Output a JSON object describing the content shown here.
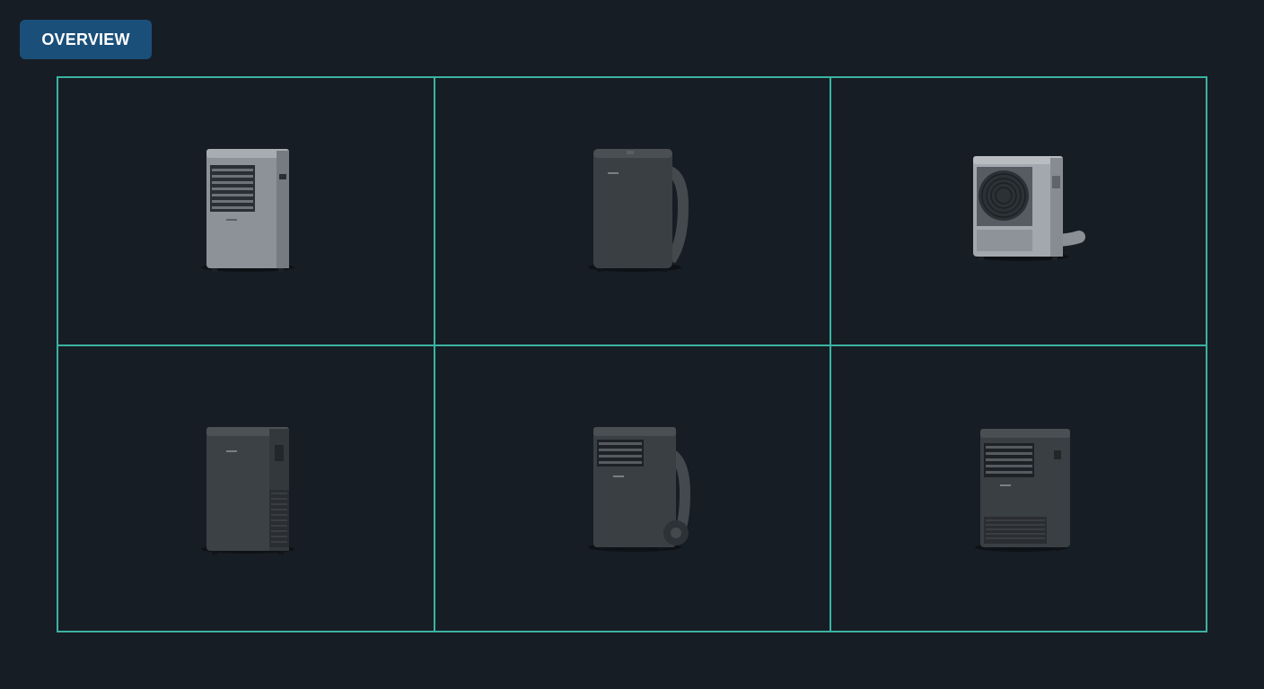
{
  "header": {
    "badge_label": "OVERVIEW"
  },
  "colors": {
    "background": "#171d24",
    "grid_lines": "#3bb3a2",
    "badge": "#1a4f7a"
  },
  "products": [
    {
      "name": "portable-ac-unit-light-grey-front-vents",
      "color": "light-grey"
    },
    {
      "name": "portable-ac-unit-dark-with-hose",
      "color": "dark-grey"
    },
    {
      "name": "portable-ac-unit-light-grey-fan-grille",
      "color": "light-grey"
    },
    {
      "name": "portable-ac-unit-dark-side-grille",
      "color": "dark-grey"
    },
    {
      "name": "portable-ac-unit-dark-with-wheel-and-hose",
      "color": "dark-grey"
    },
    {
      "name": "portable-ac-unit-dark-front-and-bottom-vents",
      "color": "dark-grey"
    }
  ]
}
